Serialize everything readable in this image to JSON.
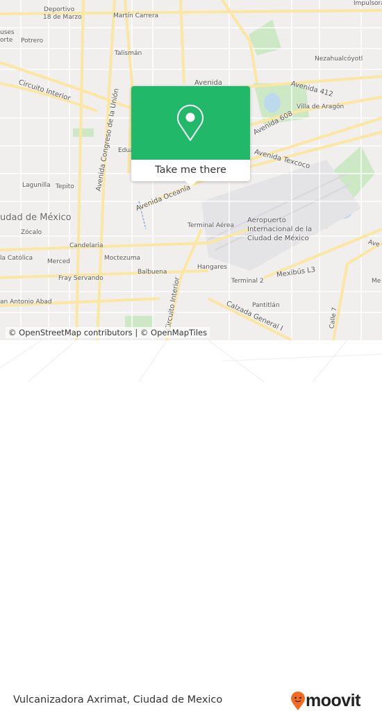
{
  "map": {
    "labels": {
      "deportivo": "Deportivo",
      "marzo": "18 de Marzo",
      "martin": "Martín Carrera",
      "impulsora": "Impulsora",
      "uses": "uses",
      "orte": "orte",
      "potrero": "Potrero",
      "talisman": "Talismán",
      "neza": "Nezahualcóyotl",
      "circuito": "Circuito Interior",
      "congreso": "Avenida Congreso de la Unión",
      "av412": "Avenida 412",
      "avenida": "Avenida",
      "villa": "Villa de Aragón",
      "av608": "Avenida 608",
      "texcoco": "Avenida Texcoco",
      "edua": "Edua",
      "lagunilla": "Lagunilla",
      "tepito": "Tepito",
      "oceania": "Avenida Oceanía",
      "cdmx": "udad de México",
      "zocalo": "Zócalo",
      "terminal": "Terminal Aérea",
      "aero1": "Aeropuerto",
      "aero2": "Internacional de la",
      "aero3": "Ciudad de México",
      "candelaria": "Candelaria",
      "moctezuma": "Moctezuma",
      "catolica": "la Católica",
      "merced": "Merced",
      "hangares": "Hangares",
      "balbuena": "Balbuena",
      "mexibus": "Mexibús L3",
      "fray": "Fray Servando",
      "terminal2": "Terminal 2",
      "circuito2": "Circuito Interior",
      "abad": "an Antonio Abad",
      "pantitlan": "Pantitlán",
      "calzada": "Calzada General I",
      "calle7": "Calle 7",
      "ave": "Ave",
      "me": "Me"
    },
    "attribution": "© OpenStreetMap contributors | © OpenMapTiles"
  },
  "popup": {
    "icon": "map-pin-icon",
    "button_label": "Take me there",
    "color": "#21b86a"
  },
  "footer": {
    "place": "Vulcanizadora Axrimat, Ciudad de Mexico",
    "logo": "moovit",
    "logo_color": "#f26b21"
  }
}
